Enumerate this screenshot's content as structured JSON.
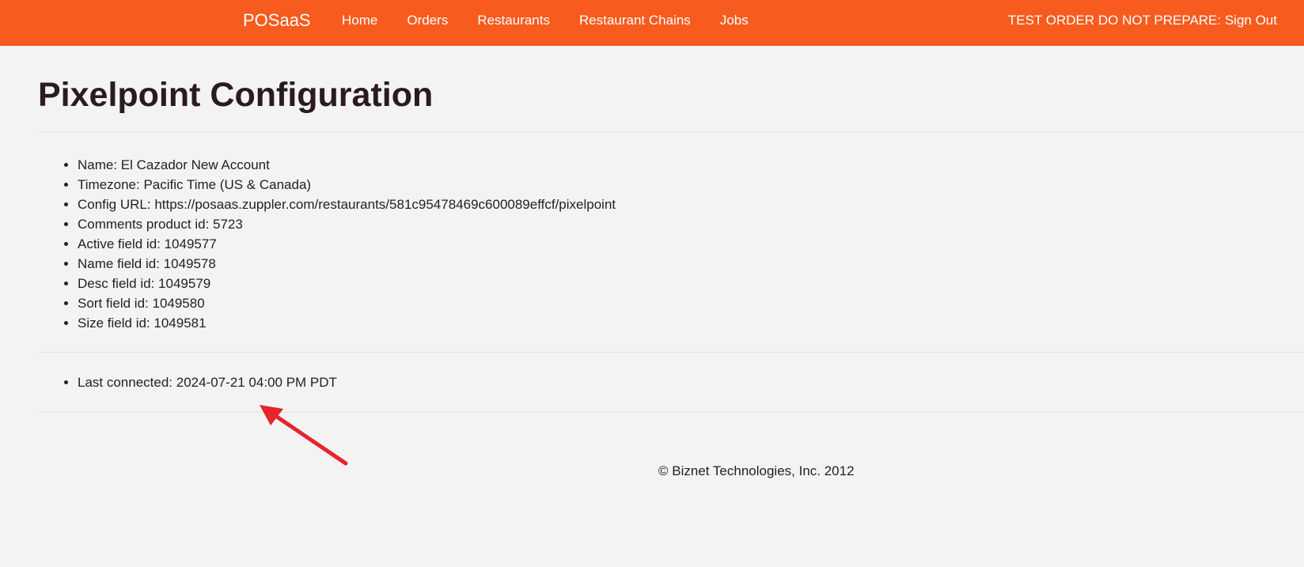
{
  "navbar": {
    "brand": "POSaaS",
    "links": [
      "Home",
      "Orders",
      "Restaurants",
      "Restaurant Chains",
      "Jobs"
    ],
    "user_action": "TEST ORDER DO NOT PREPARE: Sign Out",
    "color": "#f75b1d"
  },
  "page": {
    "title": "Pixelpoint Configuration"
  },
  "details": [
    "Name: El Cazador New Account",
    "Timezone: Pacific Time (US & Canada)",
    "Config URL: https://posaas.zuppler.com/restaurants/581c95478469c600089effcf/pixelpoint",
    "Comments product id: 5723",
    "Active field id: 1049577",
    "Name field id: 1049578",
    "Desc field id: 1049579",
    "Sort field id: 1049580",
    "Size field id: 1049581"
  ],
  "connection": {
    "last_connected": "Last connected: 2024-07-21 04:00 PM PDT"
  },
  "footer": {
    "copyright": "© Biznet Technologies, Inc. 2012"
  },
  "annotation": {
    "arrow_color": "#e5242b"
  }
}
